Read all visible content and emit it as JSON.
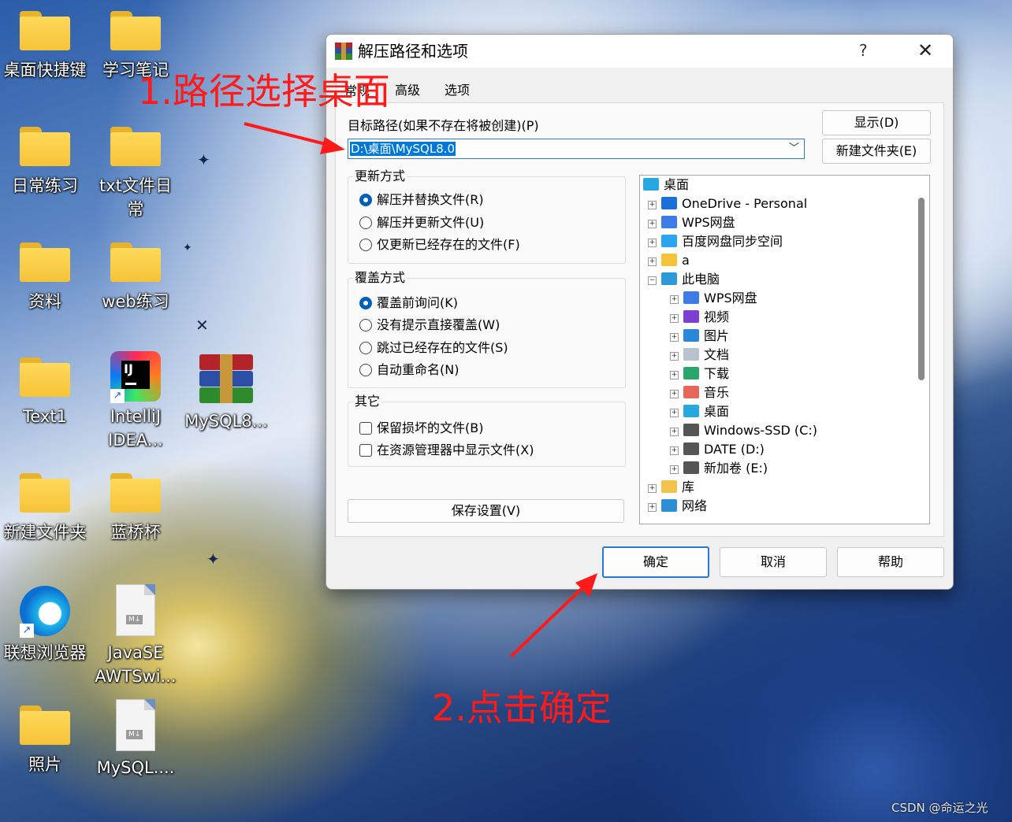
{
  "desktop": {
    "icons": [
      {
        "label": "桌面快捷键",
        "icon": "folder-icon"
      },
      {
        "label": "学习笔记",
        "icon": "folder-icon"
      },
      {
        "label": "日常练习",
        "icon": "folder-icon"
      },
      {
        "label": "txt文件日常",
        "icon": "folder-icon"
      },
      {
        "label": "资料",
        "icon": "folder-icon"
      },
      {
        "label": "web练习",
        "icon": "folder-icon"
      },
      {
        "label": "Text1",
        "icon": "folder-icon"
      },
      {
        "label": "IntelliJ IDEA...",
        "icon": "intellij-icon",
        "badge": "IJ"
      },
      {
        "label": "MySQL8...",
        "icon": "winrar-archive-icon"
      },
      {
        "label": "新建文件夹",
        "icon": "folder-icon"
      },
      {
        "label": "蓝桥杯",
        "icon": "folder-icon"
      },
      {
        "label": "联想浏览器",
        "icon": "browser-icon"
      },
      {
        "label": "JavaSE AWTSwi...",
        "icon": "markdown-file-icon",
        "badge": "M↓"
      },
      {
        "label": "照片",
        "icon": "folder-icon"
      },
      {
        "label": "MySQL....",
        "icon": "markdown-file-icon",
        "badge": "M↓"
      }
    ],
    "watermark": "CSDN @命运之光"
  },
  "dialog": {
    "title": "解压路径和选项",
    "help_glyph": "?",
    "close_glyph": "✕",
    "tabs": [
      "常规",
      "高级",
      "选项"
    ],
    "target_path_label": "目标路径(如果不存在将被创建)(P)",
    "target_path_value": "D:\\桌面\\MySQL8.0",
    "show_button": "显示(D)",
    "new_folder_button": "新建文件夹(E)",
    "update_mode": {
      "title": "更新方式",
      "options": [
        "解压并替换文件(R)",
        "解压并更新文件(U)",
        "仅更新已经存在的文件(F)"
      ],
      "selected": "解压并替换文件(R)"
    },
    "overwrite_mode": {
      "title": "覆盖方式",
      "options": [
        "覆盖前询问(K)",
        "没有提示直接覆盖(W)",
        "跳过已经存在的文件(S)",
        "自动重命名(N)"
      ],
      "selected": "覆盖前询问(K)"
    },
    "misc": {
      "title": "其它",
      "options": [
        "保留损坏的文件(B)",
        "在资源管理器中显示文件(X)"
      ]
    },
    "save_settings_button": "保存设置(V)",
    "tree": [
      {
        "label": "桌面",
        "icon": "desktop-icon",
        "expander": ""
      },
      {
        "label": "OneDrive - Personal",
        "icon": "onedrive-icon",
        "expander": "+"
      },
      {
        "label": "WPS网盘",
        "icon": "wps-cloud-icon",
        "expander": "+"
      },
      {
        "label": "百度网盘同步空间",
        "icon": "baidu-cloud-icon",
        "expander": "+"
      },
      {
        "label": "a",
        "icon": "folder-icon",
        "expander": "+"
      },
      {
        "label": "此电脑",
        "icon": "computer-icon",
        "expander": "−"
      },
      {
        "label": "WPS网盘",
        "icon": "wps-cloud-icon",
        "expander": "+"
      },
      {
        "label": "视频",
        "icon": "video-icon",
        "expander": "+"
      },
      {
        "label": "图片",
        "icon": "pictures-icon",
        "expander": "+"
      },
      {
        "label": "文档",
        "icon": "documents-icon",
        "expander": "+"
      },
      {
        "label": "下载",
        "icon": "download-icon",
        "expander": "+"
      },
      {
        "label": "音乐",
        "icon": "music-icon",
        "expander": "+"
      },
      {
        "label": "桌面",
        "icon": "desktop-icon",
        "expander": "+"
      },
      {
        "label": "Windows-SSD (C:)",
        "icon": "drive-icon",
        "expander": "+"
      },
      {
        "label": "DATE (D:)",
        "icon": "drive-icon",
        "expander": "+"
      },
      {
        "label": "新加卷 (E:)",
        "icon": "drive-icon",
        "expander": "+"
      },
      {
        "label": "库",
        "icon": "library-icon",
        "expander": "+"
      },
      {
        "label": "网络",
        "icon": "network-icon",
        "expander": "+"
      }
    ],
    "ok_button": "确定",
    "cancel_button": "取消",
    "help_button": "帮助"
  },
  "annotations": {
    "step1": "1.路径选择桌面",
    "step2": "2.点击确定",
    "color": "#ff1a1a"
  }
}
